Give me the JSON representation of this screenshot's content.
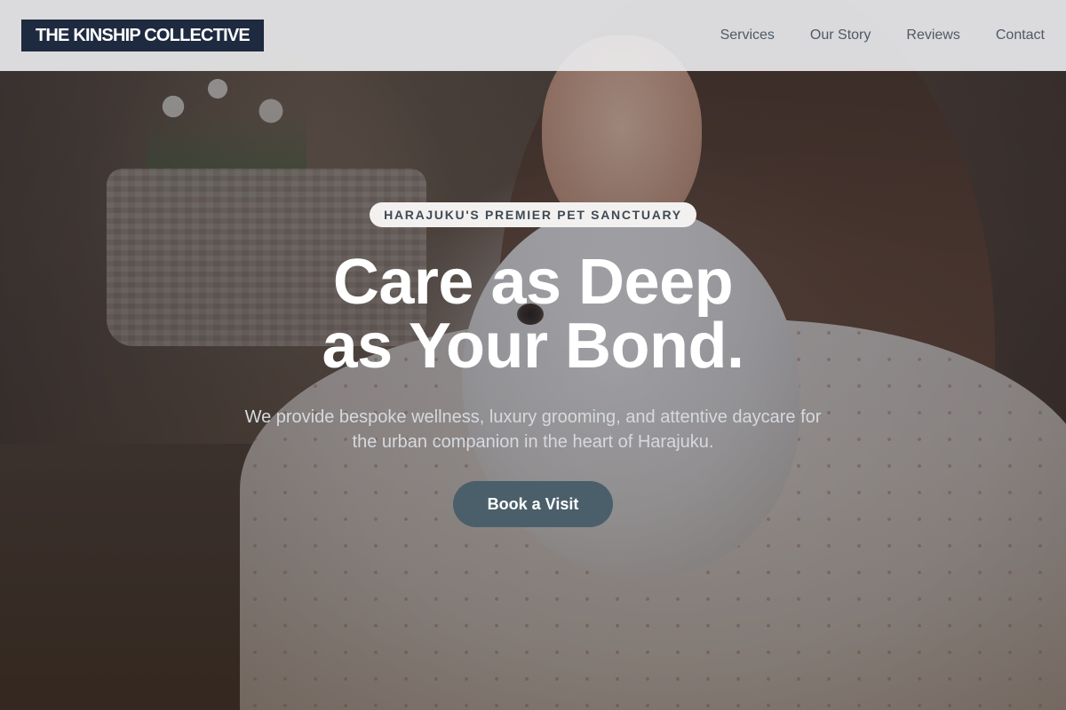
{
  "header": {
    "logo": "THE KINSHIP COLLECTIVE",
    "nav": [
      {
        "label": "Services"
      },
      {
        "label": "Our Story"
      },
      {
        "label": "Reviews"
      },
      {
        "label": "Contact"
      }
    ]
  },
  "hero": {
    "badge": "HARAJUKU'S PREMIER PET SANCTUARY",
    "headline_line1": "Care as Deep",
    "headline_line2": "as Your Bond.",
    "subtext": "We provide bespoke wellness, luxury grooming, and attentive daycare for the urban companion in the heart of Harajuku.",
    "cta_label": "Book a Visit"
  },
  "colors": {
    "logo_bg": "#1e2a3f",
    "cta_bg": "#4b5f6a",
    "header_bg": "#ececee",
    "nav_text": "#4e5a67"
  }
}
